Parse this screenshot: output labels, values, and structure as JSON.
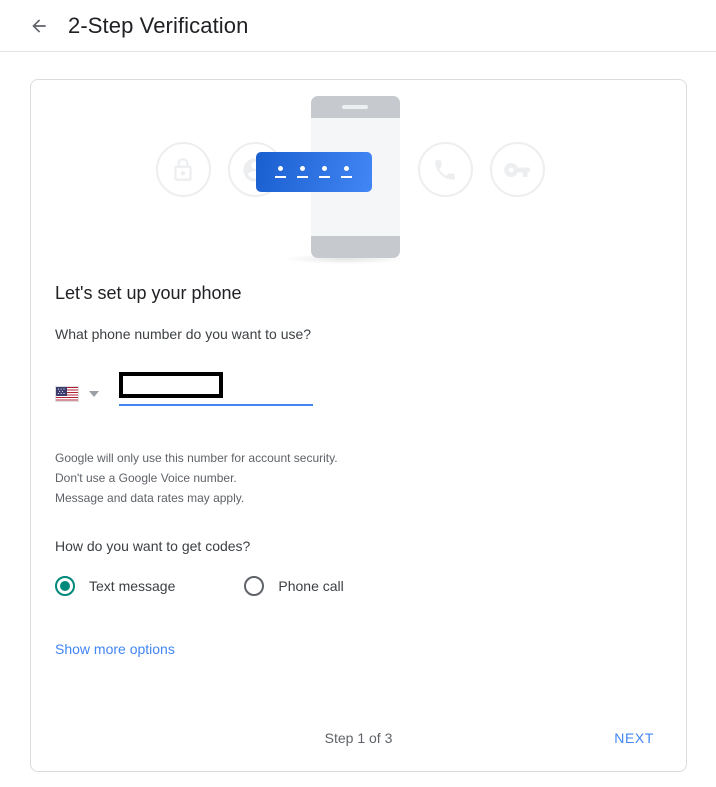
{
  "header": {
    "back_icon": "arrow-left-icon",
    "title": "2-Step Verification"
  },
  "illustration": {
    "icons": [
      {
        "name": "lock-icon"
      },
      {
        "name": "account-circle-icon"
      },
      {
        "name": "phone-device-icon"
      },
      {
        "name": "phone-call-icon"
      },
      {
        "name": "key-icon"
      }
    ],
    "code_slots": 4,
    "banner_color": "#4285f4"
  },
  "main": {
    "section_title": "Let's set up your phone",
    "question": "What phone number do you want to use?",
    "country": {
      "flag": "us-flag-icon",
      "caret": "chevron-down-icon"
    },
    "phone_input": {
      "value": "",
      "placeholder": ""
    },
    "helper_lines": [
      "Google will only use this number for account security.",
      "Don't use a Google Voice number.",
      "Message and data rates may apply."
    ],
    "codes_question": "How do you want to get codes?",
    "radio_options": [
      {
        "label": "Text message",
        "selected": true
      },
      {
        "label": "Phone call",
        "selected": false
      }
    ],
    "more_options_link": "Show more options"
  },
  "footer": {
    "step_text": "Step 1 of 3",
    "next_label": "NEXT"
  },
  "colors": {
    "accent_blue": "#4285f4",
    "radio_teal": "#00897b",
    "text_primary": "#202124",
    "text_secondary": "#5f6368",
    "card_border": "#dadce0"
  }
}
